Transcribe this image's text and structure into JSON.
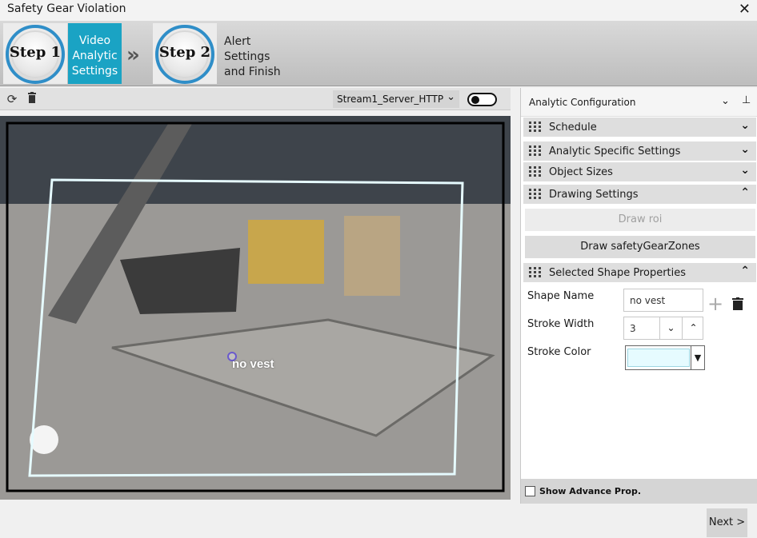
{
  "window": {
    "title": "Safety Gear Violation",
    "close_glyph": "✕"
  },
  "wizard": {
    "steps": [
      {
        "badge": "Step 1",
        "label": "Video Analytic Settings",
        "active": true
      },
      {
        "badge": "Step 2",
        "label": "Alert Settings and Finish",
        "active": false
      }
    ],
    "arrow_glyph": "»"
  },
  "video_toolbar": {
    "refresh_icon": "refresh-icon",
    "delete_icon": "trash-icon",
    "stream": "Stream1_Server_HTTP",
    "toggle_on": false
  },
  "video": {
    "shape_label": "no vest",
    "roi_color": "#000000",
    "zone_color": "#e6fbff"
  },
  "panel": {
    "title": "Analytic Configuration",
    "sections": {
      "schedule": "Schedule",
      "analytic_specific": "Analytic Specific Settings",
      "object_sizes": "Object Sizes",
      "drawing": "Drawing Settings",
      "selected_shape": "Selected Shape Properties"
    },
    "buttons": {
      "draw_roi": "Draw roi",
      "draw_zones": "Draw safetyGearZones"
    },
    "props": {
      "shape_name_label": "Shape Name",
      "shape_name_value": "no vest",
      "stroke_width_label": "Stroke Width",
      "stroke_width_value": "3",
      "stroke_color_label": "Stroke Color",
      "stroke_color_value": "#e6fbff"
    },
    "advance": {
      "label": "Show Advance Prop.",
      "checked": false
    }
  },
  "footer": {
    "next": "Next >"
  }
}
